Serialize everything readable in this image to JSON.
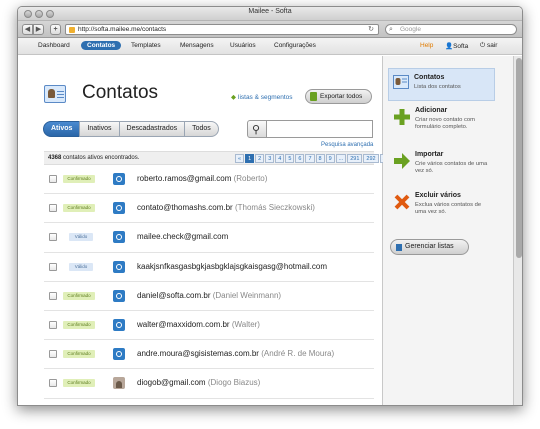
{
  "window": {
    "title": "Mailee - Softa"
  },
  "browser": {
    "url": "http://softa.mailee.me/contacts",
    "search_placeholder": "Google"
  },
  "nav": {
    "items": [
      "Dashboard",
      "Contatos",
      "Templates",
      "Mensagens",
      "Usuários",
      "Configurações"
    ],
    "help": "Help",
    "user": "Softa",
    "logout": "sair"
  },
  "page": {
    "title": "Contatos",
    "lists_link": "listas & segmentos",
    "export_button": "Exportar todos",
    "tabs": [
      "Ativos",
      "Inativos",
      "Descadastrados",
      "Todos"
    ],
    "advanced_search": "Pesquisa avançada",
    "count_number": "4368",
    "count_text": " contatos ativos encontrados.",
    "pager": [
      "«",
      "1",
      "2",
      "3",
      "4",
      "5",
      "6",
      "7",
      "8",
      "9",
      "...",
      "291",
      "292",
      "»"
    ]
  },
  "contacts": [
    {
      "status": "Confirmado",
      "email": "roberto.ramos@gmail.com",
      "name": "(Roberto)"
    },
    {
      "status": "Confirmado",
      "email": "contato@thomashs.com.br",
      "name": "(Thomás Sieczkowski)"
    },
    {
      "status": "Válido",
      "email": "mailee.check@gmail.com",
      "name": ""
    },
    {
      "status": "Válido",
      "email": "kaakjsnfkasgasbgkjasbgklajsgkaisgasg@hotmail.com",
      "name": ""
    },
    {
      "status": "Confirmado",
      "email": "daniel@softa.com.br",
      "name": "(Daniel Weinmann)"
    },
    {
      "status": "Confirmado",
      "email": "walter@maxxidom.com.br",
      "name": "(Walter)"
    },
    {
      "status": "Confirmado",
      "email": "andre.moura@sgisistemas.com.br",
      "name": "(André R. de Moura)"
    },
    {
      "status": "Confirmado",
      "email": "diogob@gmail.com",
      "name": "(Diogo Biazus)"
    }
  ],
  "sidebar": {
    "items": [
      {
        "title": "Contatos",
        "desc": "Lista dos contatos"
      },
      {
        "title": "Adicionar",
        "desc": "Criar novo contato com formulário completo."
      },
      {
        "title": "Importar",
        "desc": "Crie vários contatos de uma vez só."
      },
      {
        "title": "Excluir vários",
        "desc": "Exclua vários contatos de uma vez só."
      }
    ],
    "manage_lists": "Gerenciar listas"
  }
}
